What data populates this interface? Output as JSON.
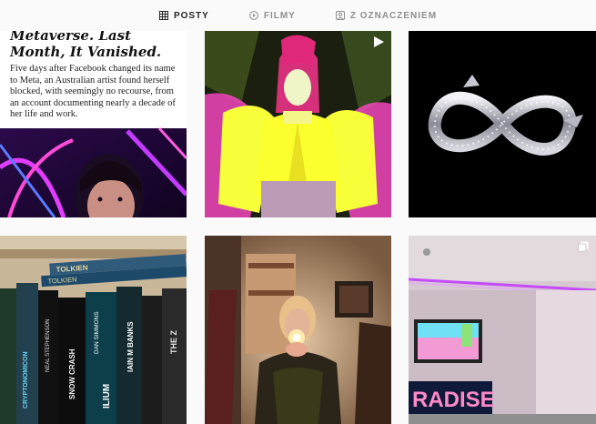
{
  "tabs": [
    {
      "label": "POSTY",
      "icon": "grid-icon",
      "active": true
    },
    {
      "label": "FILMY",
      "icon": "play-circle-icon",
      "active": false
    },
    {
      "label": "Z OZNACZENIEM",
      "icon": "tagged-user-icon",
      "active": false
    }
  ],
  "posts": [
    {
      "type": "news-screenshot",
      "headline": "Metaverse. Last Month, It Vanished.",
      "body": "Five days after Facebook changed its name to Meta, an Australian artist found herself blocked, with seemingly no recourse, from an account documenting nearly a decade of her life and work."
    },
    {
      "type": "video",
      "icon": "video-icon"
    },
    {
      "type": "image"
    },
    {
      "type": "image",
      "book_spines": [
        "TOLKIEN",
        "TOLKIEN",
        "CRYPTONOMICON",
        "NEAL STEPHENSON",
        "SNOW CRASH",
        "DAN SIMMONS",
        "ILIUM",
        "IAIN M BANKS",
        "THE Z"
      ]
    },
    {
      "type": "image"
    },
    {
      "type": "carousel",
      "icon": "carousel-icon",
      "sign_text": "RADISE"
    }
  ]
}
